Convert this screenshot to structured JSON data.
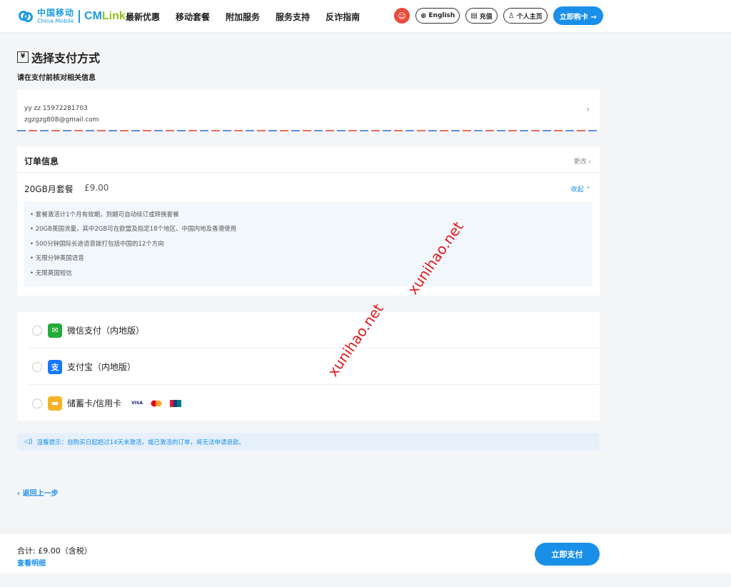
{
  "header": {
    "logo_cn": "中国移动",
    "logo_en": "China Mobile",
    "logo_brand_a": "CM",
    "logo_brand_b": "Link",
    "nav": [
      "最新优惠",
      "移动套餐",
      "附加服务",
      "服务支持",
      "反诈指南"
    ],
    "language": "English",
    "recharge": "充值",
    "profile": "个人主页",
    "buy_now": "立即购卡 →"
  },
  "page": {
    "title": "选择支付方式",
    "subtitle": "请在支付前核对相关信息"
  },
  "address": {
    "line1": "yy  zz   15972281703",
    "line2": "zgzgzg808@gmail.com"
  },
  "order": {
    "heading": "订单信息",
    "edit": "更改 ›",
    "plan_name": "20GB月套餐",
    "price": "£9.00",
    "collapse": "收起 ⌃",
    "features": [
      "• 套餐激活计1个月有效期，到期可自动续订或转换套餐",
      "• 20GB英国流量，其中2GB可在欧盟及指定18个地区、中国内地及香港使用",
      "• 500分钟国际长途语音拨打包括中国的12个方向",
      "• 无限分钟英国语音",
      "• 无限英国短信"
    ]
  },
  "payment": {
    "methods": [
      {
        "label": "微信支付（内地版）",
        "icon": "wechat-pay-icon",
        "color": "#22ac38"
      },
      {
        "label": "支付宝（内地版）",
        "icon": "alipay-icon",
        "color": "#1677ff"
      },
      {
        "label": "储蓄卡/信用卡",
        "icon": "bank-card-icon",
        "color": "#f5b527"
      }
    ],
    "card_brands": [
      "VISA",
      "mastercard-icon",
      "unionpay-icon"
    ]
  },
  "tip": "温馨提示：自购买日起超过14天未激活，或已激活的订单，将无法申请退款。",
  "back": "‹  返回上一步",
  "footer": {
    "total": "合计: £9.00（含税）",
    "detail": "查看明细",
    "pay_button": "立即支付"
  },
  "watermark": [
    "xunihao.net",
    "xunihao.net"
  ],
  "colors": {
    "accent": "#1a8fe8",
    "brand": "#1a9be0",
    "watermark": "#e01b1b"
  }
}
